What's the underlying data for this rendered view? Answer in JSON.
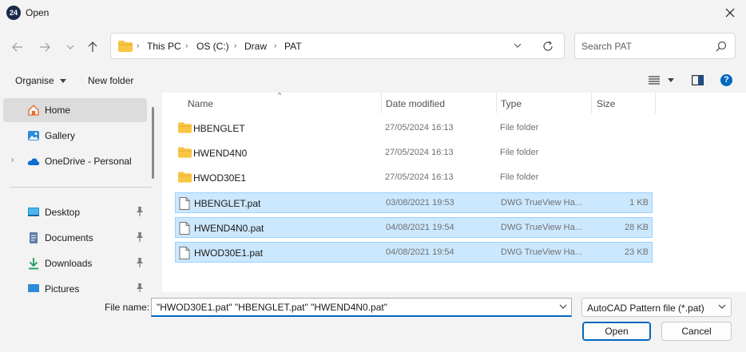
{
  "window": {
    "title": "Open",
    "app_icon_text": "24"
  },
  "nav": {
    "breadcrumbs": [
      "This PC",
      "OS (C:)",
      "Draw",
      "PAT"
    ],
    "search_placeholder": "Search PAT"
  },
  "toolbar": {
    "organise_label": "Organise",
    "new_folder_label": "New folder"
  },
  "sidebar": {
    "items": [
      {
        "label": "Home",
        "icon": "home-icon"
      },
      {
        "label": "Gallery",
        "icon": "gallery-icon"
      },
      {
        "label": "OneDrive - Personal",
        "icon": "cloud-icon"
      },
      {
        "label": "Desktop",
        "icon": "desktop-icon"
      },
      {
        "label": "Documents",
        "icon": "documents-icon"
      },
      {
        "label": "Downloads",
        "icon": "download-icon"
      },
      {
        "label": "Pictures",
        "icon": "pictures-icon"
      }
    ]
  },
  "columns": {
    "name": "Name",
    "date": "Date modified",
    "type": "Type",
    "size": "Size"
  },
  "files": [
    {
      "name": "HBENGLET",
      "date": "27/05/2024 16:13",
      "type": "File folder",
      "size": "",
      "kind": "folder",
      "selected": false
    },
    {
      "name": "HWEND4N0",
      "date": "27/05/2024 16:13",
      "type": "File folder",
      "size": "",
      "kind": "folder",
      "selected": false
    },
    {
      "name": "HWOD30E1",
      "date": "27/05/2024 16:13",
      "type": "File folder",
      "size": "",
      "kind": "folder",
      "selected": false
    },
    {
      "name": "HBENGLET.pat",
      "date": "03/08/2021 19:53",
      "type": "DWG TrueView Ha...",
      "size": "1 KB",
      "kind": "file",
      "selected": true
    },
    {
      "name": "HWEND4N0.pat",
      "date": "04/08/2021 19:54",
      "type": "DWG TrueView Ha...",
      "size": "28 KB",
      "kind": "file",
      "selected": true
    },
    {
      "name": "HWOD30E1.pat",
      "date": "04/08/2021 19:54",
      "type": "DWG TrueView Ha...",
      "size": "23 KB",
      "kind": "file",
      "selected": true
    }
  ],
  "footer": {
    "filename_label": "File name:",
    "filename_value": "\"HWOD30E1.pat\" \"HBENGLET.pat\" \"HWEND4N0.pat\"",
    "filetype": "AutoCAD Pattern file (*.pat)",
    "open_label": "Open",
    "cancel_label": "Cancel"
  },
  "colors": {
    "accent": "#0067c0",
    "selection": "#cce8ff",
    "folder": "#f8c544"
  }
}
